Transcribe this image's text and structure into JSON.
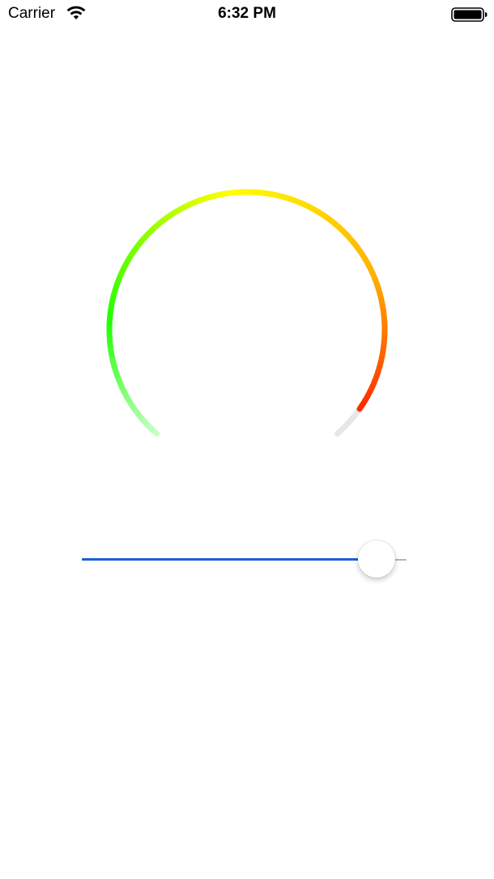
{
  "status_bar": {
    "carrier": "Carrier",
    "time": "6:32 PM",
    "wifi_icon": "wifi-icon",
    "battery_icon": "battery-full-icon"
  },
  "gauge": {
    "value": 0.95,
    "track_color": "#e6e6e6",
    "gradient_colors": [
      "#caffc9",
      "#1eff00",
      "#ffff00",
      "#ffb000",
      "#ff2a00"
    ]
  },
  "slider": {
    "value": 0.91,
    "min_track_color": "#1a5fd6",
    "max_track_color": "#b5b5b5"
  }
}
